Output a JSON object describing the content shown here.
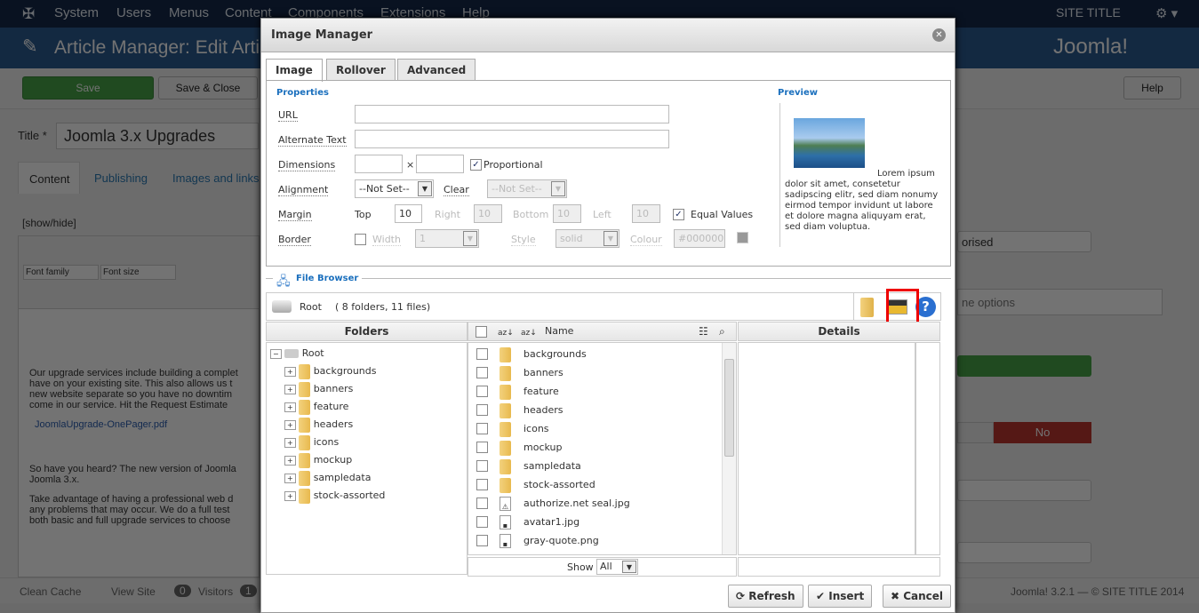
{
  "background": {
    "nav": [
      "System",
      "Users",
      "Menus",
      "Content",
      "Components",
      "Extensions",
      "Help"
    ],
    "site_title": "SITE TITLE",
    "page_title": "Article Manager: Edit Article",
    "logo_text": "Joomla!",
    "save": "Save",
    "save_close": "Save & Close",
    "help": "Help",
    "title_label": "Title *",
    "title_value": "Joomla 3.x Upgrades",
    "tabs": [
      "Content",
      "Publishing",
      "Images and links"
    ],
    "show_hide": "[show/hide]",
    "font_family": "Font family",
    "font_size": "Font size",
    "para1": [
      "Our upgrade services include building a complet",
      "have on your existing site.  This also allows us t",
      "new website separate so you have no downtim",
      "come in our service.  Hit the Request Estimate"
    ],
    "pdf_link": "JoomlaUpgrade-OnePager.pdf",
    "para2": [
      "So have you heard? The new version of Joomla",
      "Joomla 3.x."
    ],
    "para3": [
      "Take advantage of having a professional web d",
      "any problems that may occur. We do a full test",
      "both basic and full upgrade services to choose"
    ],
    "right_select": "orised",
    "right_input_placeholder": "ne options",
    "toggle_no": "No",
    "status": {
      "clean_cache": "Clean Cache",
      "view_site": "View Site",
      "visitors_count": "0",
      "visitors": "Visitors",
      "admins_count": "1"
    },
    "footer": "Joomla! 3.2.1 — © SITE TITLE 2014"
  },
  "modal": {
    "title": "Image Manager",
    "tabs": [
      "Image",
      "Rollover",
      "Advanced"
    ],
    "properties_heading": "Properties",
    "preview_heading": "Preview",
    "url_label": "URL",
    "url_value": "",
    "alt_label": "Alternate Text",
    "alt_value": "",
    "dimensions_label": "Dimensions",
    "dim_sep": "×",
    "proportional": "Proportional",
    "proportional_checked": true,
    "alignment_label": "Alignment",
    "alignment_value": "--Not Set--",
    "clear_label": "Clear",
    "clear_value": "--Not Set--",
    "margin_label": "Margin",
    "top": "Top",
    "top_value": "10",
    "right": "Right",
    "right_value": "10",
    "bottom": "Bottom",
    "bottom_value": "10",
    "left": "Left",
    "left_value": "10",
    "equal_values": "Equal Values",
    "equal_checked": true,
    "border_label": "Border",
    "width_label": "Width",
    "width_value": "1",
    "style_label": "Style",
    "style_value": "solid",
    "colour_label": "Colour",
    "colour_value": "#000000",
    "preview_text": "Lorem ipsum dolor sit amet, consetetur sadipscing elitr, sed diam nonumy eirmod tempor invidunt ut labore et dolore magna aliquyam erat, sed diam voluptua.",
    "file_browser": {
      "legend": "File Browser",
      "path": "Root",
      "summary": "( 8 folders, 11 files)",
      "folders_header": "Folders",
      "name_header": "Name",
      "details_header": "Details",
      "tree_root": "Root",
      "tree": [
        "backgrounds",
        "banners",
        "feature",
        "headers",
        "icons",
        "mockup",
        "sampledata",
        "stock-assorted"
      ],
      "files": [
        {
          "name": "backgrounds",
          "type": "folder"
        },
        {
          "name": "banners",
          "type": "folder"
        },
        {
          "name": "feature",
          "type": "folder"
        },
        {
          "name": "headers",
          "type": "folder"
        },
        {
          "name": "icons",
          "type": "folder"
        },
        {
          "name": "mockup",
          "type": "folder"
        },
        {
          "name": "sampledata",
          "type": "folder"
        },
        {
          "name": "stock-assorted",
          "type": "folder"
        },
        {
          "name": "authorize.net seal.jpg",
          "type": "warning"
        },
        {
          "name": "avatar1.jpg",
          "type": "image"
        },
        {
          "name": "gray-quote.png",
          "type": "image"
        }
      ],
      "show_label": "Show",
      "show_value": "All",
      "highlight_color": "#ee0000"
    },
    "buttons": {
      "refresh": "Refresh",
      "insert": "Insert",
      "cancel": "Cancel"
    }
  }
}
